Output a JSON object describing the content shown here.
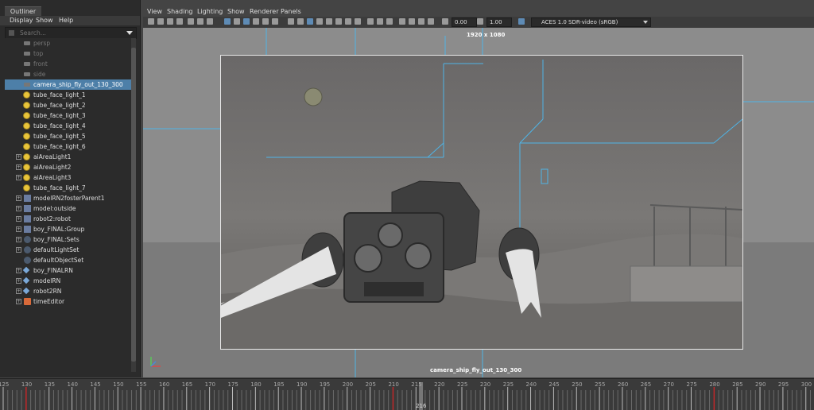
{
  "outliner": {
    "tab_label": "Outliner",
    "menu": [
      "Display",
      "Show",
      "Help"
    ],
    "search_placeholder": "Search...",
    "items": [
      {
        "label": "persp",
        "icon": "camera-icon",
        "type": "cam",
        "dim": true,
        "expand": false
      },
      {
        "label": "top",
        "icon": "camera-icon",
        "type": "cam",
        "dim": true,
        "expand": false
      },
      {
        "label": "front",
        "icon": "camera-icon",
        "type": "cam",
        "dim": true,
        "expand": false
      },
      {
        "label": "side",
        "icon": "camera-icon",
        "type": "cam",
        "dim": true,
        "expand": false
      },
      {
        "label": "camera_ship_fly_out_130_300",
        "icon": "camera-icon",
        "type": "cam",
        "selected": true,
        "expand": false
      },
      {
        "label": "tube_face_light_1",
        "icon": "light-icon",
        "type": "light",
        "expand": false
      },
      {
        "label": "tube_face_light_2",
        "icon": "light-icon",
        "type": "light",
        "expand": false
      },
      {
        "label": "tube_face_light_3",
        "icon": "light-icon",
        "type": "light",
        "expand": false
      },
      {
        "label": "tube_face_light_4",
        "icon": "light-icon",
        "type": "light",
        "expand": false
      },
      {
        "label": "tube_face_light_5",
        "icon": "light-icon",
        "type": "light",
        "expand": false
      },
      {
        "label": "tube_face_light_6",
        "icon": "light-icon",
        "type": "light",
        "expand": false
      },
      {
        "label": "aiAreaLight1",
        "icon": "light-icon",
        "type": "light",
        "expand": true
      },
      {
        "label": "aiAreaLight2",
        "icon": "light-icon",
        "type": "light",
        "expand": true
      },
      {
        "label": "aiAreaLight3",
        "icon": "light-icon",
        "type": "light",
        "expand": true
      },
      {
        "label": "tube_face_light_7",
        "icon": "light-icon",
        "type": "light",
        "expand": false
      },
      {
        "label": "modelRN2fosterParent1",
        "icon": "group-icon",
        "type": "group",
        "expand": true
      },
      {
        "label": "model:outside",
        "icon": "group-icon",
        "type": "group",
        "expand": true
      },
      {
        "label": "robot2:robot",
        "icon": "group-icon",
        "type": "group",
        "expand": true
      },
      {
        "label": "boy_FINAL:Group",
        "icon": "group-icon",
        "type": "group",
        "expand": true
      },
      {
        "label": "boy_FINAL:Sets",
        "icon": "set-icon",
        "type": "set",
        "expand": true
      },
      {
        "label": "defaultLightSet",
        "icon": "set-icon",
        "type": "set",
        "expand": true
      },
      {
        "label": "defaultObjectSet",
        "icon": "set-icon",
        "type": "set",
        "expand": false
      },
      {
        "label": "boy_FINALRN",
        "icon": "reference-icon",
        "type": "shape",
        "expand": true
      },
      {
        "label": "modelRN",
        "icon": "reference-icon",
        "type": "shape",
        "expand": true
      },
      {
        "label": "robot2RN",
        "icon": "reference-icon",
        "type": "shape",
        "expand": true
      },
      {
        "label": "timeEditor",
        "icon": "time-editor-icon",
        "type": "time",
        "expand": true
      }
    ]
  },
  "viewport": {
    "menu": [
      "View",
      "Shading",
      "Lighting",
      "Show",
      "Renderer",
      "Panels"
    ],
    "exposure": "0.00",
    "gamma": "1.00",
    "colorspace": "ACES 1.0 SDR-video (sRGB)",
    "resolution": "1920 x 1080",
    "camera_name": "camera_ship_fly_out_130_300"
  },
  "timeline": {
    "ticks": [
      "125",
      "130",
      "135",
      "140",
      "145",
      "150",
      "155",
      "160",
      "165",
      "170",
      "175",
      "180",
      "185",
      "190",
      "195",
      "200",
      "205",
      "210",
      "215",
      "220",
      "225",
      "230",
      "235",
      "240",
      "245",
      "250",
      "255",
      "260",
      "265",
      "270",
      "275",
      "280",
      "285",
      "290",
      "295",
      "300"
    ],
    "current_frame": "216"
  },
  "colors": {
    "selection": "#4d7fa8",
    "light_icon": "#e8c43a",
    "wireframe": "#4fb4e6",
    "keyframe": "#c0282a"
  }
}
